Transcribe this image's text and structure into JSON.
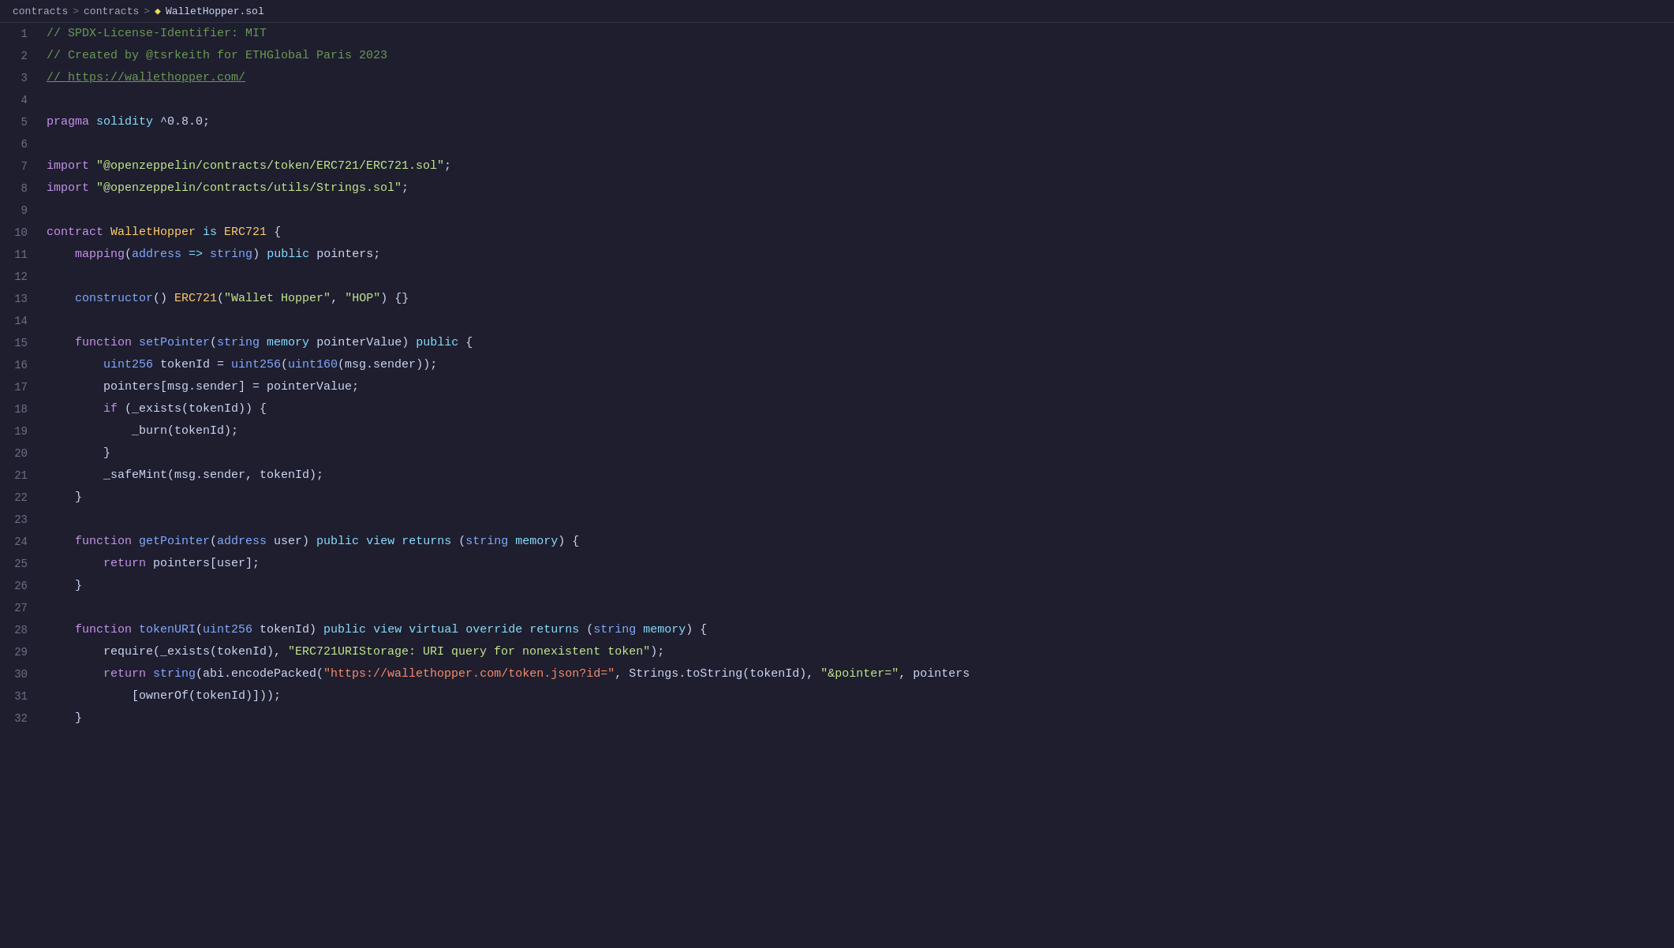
{
  "breadcrumb": {
    "part1": "contracts",
    "sep1": ">",
    "part2": "contracts",
    "sep2": ">",
    "filename": "WalletHopper.sol"
  },
  "lines": [
    {
      "num": 1,
      "tokens": [
        {
          "t": "comment",
          "v": "// SPDX-License-Identifier: MIT"
        }
      ]
    },
    {
      "num": 2,
      "tokens": [
        {
          "t": "comment",
          "v": "// Created by @tsrkeith for ETHGlobal Paris 2023"
        }
      ]
    },
    {
      "num": 3,
      "tokens": [
        {
          "t": "comment_link",
          "v": "// https://wallethopper.com/"
        }
      ]
    },
    {
      "num": 4,
      "tokens": []
    },
    {
      "num": 5,
      "tokens": [
        {
          "t": "pragma",
          "v": "pragma"
        },
        {
          "t": "plain",
          "v": " "
        },
        {
          "t": "keyword2",
          "v": "solidity"
        },
        {
          "t": "plain",
          "v": " ^0.8.0;"
        }
      ]
    },
    {
      "num": 6,
      "tokens": []
    },
    {
      "num": 7,
      "tokens": [
        {
          "t": "import",
          "v": "import"
        },
        {
          "t": "plain",
          "v": " "
        },
        {
          "t": "string",
          "v": "\"@openzeppelin/contracts/token/ERC721/ERC721.sol\""
        },
        {
          "t": "plain",
          "v": ";"
        }
      ]
    },
    {
      "num": 8,
      "tokens": [
        {
          "t": "import",
          "v": "import"
        },
        {
          "t": "plain",
          "v": " "
        },
        {
          "t": "string",
          "v": "\"@openzeppelin/contracts/utils/Strings.sol\""
        },
        {
          "t": "plain",
          "v": ";"
        }
      ]
    },
    {
      "num": 9,
      "tokens": []
    },
    {
      "num": 10,
      "tokens": [
        {
          "t": "keyword",
          "v": "contract"
        },
        {
          "t": "plain",
          "v": " "
        },
        {
          "t": "class",
          "v": "WalletHopper"
        },
        {
          "t": "plain",
          "v": " "
        },
        {
          "t": "keyword2",
          "v": "is"
        },
        {
          "t": "plain",
          "v": " "
        },
        {
          "t": "class",
          "v": "ERC721"
        },
        {
          "t": "plain",
          "v": " {"
        }
      ]
    },
    {
      "num": 11,
      "tokens": [
        {
          "t": "plain",
          "v": "    "
        },
        {
          "t": "keyword",
          "v": "mapping"
        },
        {
          "t": "plain",
          "v": "("
        },
        {
          "t": "type",
          "v": "address"
        },
        {
          "t": "plain",
          "v": " "
        },
        {
          "t": "op",
          "v": "=>"
        },
        {
          "t": "plain",
          "v": " "
        },
        {
          "t": "type",
          "v": "string"
        },
        {
          "t": "plain",
          "v": ") "
        },
        {
          "t": "keyword2",
          "v": "public"
        },
        {
          "t": "plain",
          "v": " pointers;"
        }
      ]
    },
    {
      "num": 12,
      "tokens": []
    },
    {
      "num": 13,
      "tokens": [
        {
          "t": "plain",
          "v": "    "
        },
        {
          "t": "constructor",
          "v": "constructor"
        },
        {
          "t": "plain",
          "v": "() "
        },
        {
          "t": "class",
          "v": "ERC721"
        },
        {
          "t": "plain",
          "v": "("
        },
        {
          "t": "string",
          "v": "\"Wallet Hopper\""
        },
        {
          "t": "plain",
          "v": ", "
        },
        {
          "t": "string",
          "v": "\"HOP\""
        },
        {
          "t": "plain",
          "v": ") {}"
        }
      ]
    },
    {
      "num": 14,
      "tokens": []
    },
    {
      "num": 15,
      "tokens": [
        {
          "t": "plain",
          "v": "    "
        },
        {
          "t": "keyword",
          "v": "function"
        },
        {
          "t": "plain",
          "v": " "
        },
        {
          "t": "func",
          "v": "setPointer"
        },
        {
          "t": "plain",
          "v": "("
        },
        {
          "t": "type",
          "v": "string"
        },
        {
          "t": "plain",
          "v": " "
        },
        {
          "t": "keyword2",
          "v": "memory"
        },
        {
          "t": "plain",
          "v": " pointerValue) "
        },
        {
          "t": "keyword2",
          "v": "public"
        },
        {
          "t": "plain",
          "v": " {"
        }
      ]
    },
    {
      "num": 16,
      "tokens": [
        {
          "t": "plain",
          "v": "        "
        },
        {
          "t": "type",
          "v": "uint256"
        },
        {
          "t": "plain",
          "v": " tokenId = "
        },
        {
          "t": "type",
          "v": "uint256"
        },
        {
          "t": "plain",
          "v": "("
        },
        {
          "t": "type",
          "v": "uint160"
        },
        {
          "t": "plain",
          "v": "(msg.sender));"
        }
      ]
    },
    {
      "num": 17,
      "tokens": [
        {
          "t": "plain",
          "v": "        pointers[msg.sender] = pointerValue;"
        }
      ]
    },
    {
      "num": 18,
      "tokens": [
        {
          "t": "plain",
          "v": "        "
        },
        {
          "t": "keyword",
          "v": "if"
        },
        {
          "t": "plain",
          "v": " (_exists(tokenId)) {"
        }
      ]
    },
    {
      "num": 19,
      "tokens": [
        {
          "t": "plain",
          "v": "            _burn(tokenId);"
        }
      ]
    },
    {
      "num": 20,
      "tokens": [
        {
          "t": "plain",
          "v": "        }"
        }
      ]
    },
    {
      "num": 21,
      "tokens": [
        {
          "t": "plain",
          "v": "        _safeMint(msg.sender, tokenId);"
        }
      ]
    },
    {
      "num": 22,
      "tokens": [
        {
          "t": "plain",
          "v": "    }"
        }
      ]
    },
    {
      "num": 23,
      "tokens": []
    },
    {
      "num": 24,
      "tokens": [
        {
          "t": "plain",
          "v": "    "
        },
        {
          "t": "keyword",
          "v": "function"
        },
        {
          "t": "plain",
          "v": " "
        },
        {
          "t": "func",
          "v": "getPointer"
        },
        {
          "t": "plain",
          "v": "("
        },
        {
          "t": "type",
          "v": "address"
        },
        {
          "t": "plain",
          "v": " user) "
        },
        {
          "t": "keyword2",
          "v": "public"
        },
        {
          "t": "plain",
          "v": " "
        },
        {
          "t": "keyword2",
          "v": "view"
        },
        {
          "t": "plain",
          "v": " "
        },
        {
          "t": "keyword2",
          "v": "returns"
        },
        {
          "t": "plain",
          "v": " ("
        },
        {
          "t": "type",
          "v": "string"
        },
        {
          "t": "plain",
          "v": " "
        },
        {
          "t": "keyword2",
          "v": "memory"
        },
        {
          "t": "plain",
          "v": ") {"
        }
      ]
    },
    {
      "num": 25,
      "tokens": [
        {
          "t": "plain",
          "v": "        "
        },
        {
          "t": "keyword",
          "v": "return"
        },
        {
          "t": "plain",
          "v": " pointers[user];"
        }
      ]
    },
    {
      "num": 26,
      "tokens": [
        {
          "t": "plain",
          "v": "    }"
        }
      ]
    },
    {
      "num": 27,
      "tokens": []
    },
    {
      "num": 28,
      "tokens": [
        {
          "t": "plain",
          "v": "    "
        },
        {
          "t": "keyword",
          "v": "function"
        },
        {
          "t": "plain",
          "v": " "
        },
        {
          "t": "func",
          "v": "tokenURI"
        },
        {
          "t": "plain",
          "v": "("
        },
        {
          "t": "type",
          "v": "uint256"
        },
        {
          "t": "plain",
          "v": " tokenId) "
        },
        {
          "t": "keyword2",
          "v": "public"
        },
        {
          "t": "plain",
          "v": " "
        },
        {
          "t": "keyword2",
          "v": "view"
        },
        {
          "t": "plain",
          "v": " "
        },
        {
          "t": "keyword2",
          "v": "virtual"
        },
        {
          "t": "plain",
          "v": " "
        },
        {
          "t": "keyword2",
          "v": "override"
        },
        {
          "t": "plain",
          "v": " "
        },
        {
          "t": "keyword2",
          "v": "returns"
        },
        {
          "t": "plain",
          "v": " ("
        },
        {
          "t": "type",
          "v": "string"
        },
        {
          "t": "plain",
          "v": " "
        },
        {
          "t": "keyword2",
          "v": "memory"
        },
        {
          "t": "plain",
          "v": ") {"
        }
      ]
    },
    {
      "num": 29,
      "tokens": [
        {
          "t": "plain",
          "v": "        require(_exists(tokenId), "
        },
        {
          "t": "string",
          "v": "\"ERC721URIStorage: URI query for nonexistent token\""
        },
        {
          "t": "plain",
          "v": ");"
        }
      ]
    },
    {
      "num": 30,
      "tokens": [
        {
          "t": "plain",
          "v": "        "
        },
        {
          "t": "keyword",
          "v": "return"
        },
        {
          "t": "plain",
          "v": " "
        },
        {
          "t": "type",
          "v": "string"
        },
        {
          "t": "plain",
          "v": "(abi.encodePacked("
        },
        {
          "t": "string_url",
          "v": "\"https://wallethopper.com/token.json?id=\""
        },
        {
          "t": "plain",
          "v": ", Strings.toString(tokenId), "
        },
        {
          "t": "string",
          "v": "\"&pointer=\""
        },
        {
          "t": "plain",
          "v": ", pointers"
        }
      ]
    },
    {
      "num": 31,
      "tokens": [
        {
          "t": "plain",
          "v": "            [ownerOf(tokenId)]));"
        }
      ]
    },
    {
      "num": 32,
      "tokens": [
        {
          "t": "plain",
          "v": "    }"
        }
      ]
    }
  ]
}
